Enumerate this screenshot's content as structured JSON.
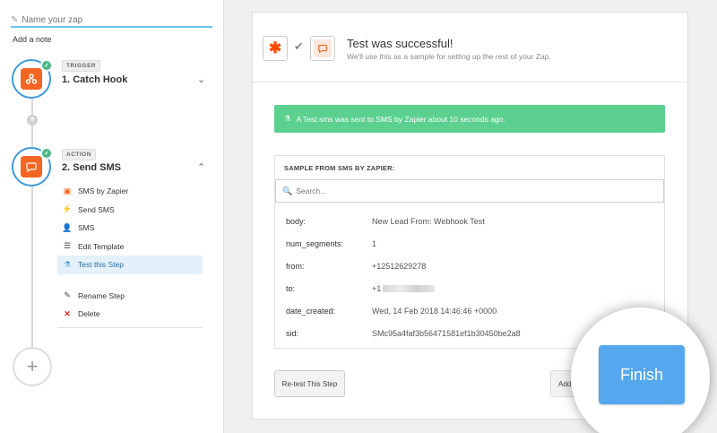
{
  "sidebar": {
    "zap_name_placeholder": "Name your zap",
    "add_note": "Add a note",
    "trigger": {
      "tag": "TRIGGER",
      "title": "1. Catch Hook"
    },
    "action": {
      "tag": "ACTION",
      "title": "2. Send SMS"
    },
    "substeps": [
      {
        "label": "SMS by Zapier",
        "icon": "sms-app-icon"
      },
      {
        "label": "Send SMS",
        "icon": "bolt-icon"
      },
      {
        "label": "SMS",
        "icon": "user-icon"
      },
      {
        "label": "Edit Template",
        "icon": "list-icon"
      },
      {
        "label": "Test this Step",
        "icon": "flask-icon",
        "active": true
      }
    ],
    "extra": [
      {
        "label": "Rename Step",
        "icon": "pencil-icon"
      },
      {
        "label": "Delete",
        "icon": "delete-x-icon"
      }
    ]
  },
  "header": {
    "title": "Test was successful!",
    "subtitle": "We'll use this as a sample for setting up the rest of your Zap."
  },
  "success_message": "A Test sms was sent to SMS by Zapier about 10 seconds ago.",
  "sample": {
    "title": "SAMPLE FROM SMS BY ZAPIER:",
    "search_placeholder": "Search...",
    "rows": [
      {
        "key": "body:",
        "value": "New Lead From: Webhook Test"
      },
      {
        "key": "num_segments:",
        "value": "1"
      },
      {
        "key": "from:",
        "value": "+12512629278"
      },
      {
        "key": "to:",
        "value": "+1"
      },
      {
        "key": "date_created:",
        "value": "Wed, 14 Feb 2018 14:46:46 +0000"
      },
      {
        "key": "sid:",
        "value": "SMc95a4faf3b56471581ef1b30450be2a8"
      }
    ]
  },
  "buttons": {
    "retest": "Re-test This Step",
    "add": "Add a",
    "finish": "Finish"
  },
  "colors": {
    "accent_blue": "#3e9ad9",
    "success_green": "#5cd08f",
    "finish_blue": "#55a7ee",
    "zapier_orange": "#ff4a00",
    "app_orange": "#f26522"
  }
}
